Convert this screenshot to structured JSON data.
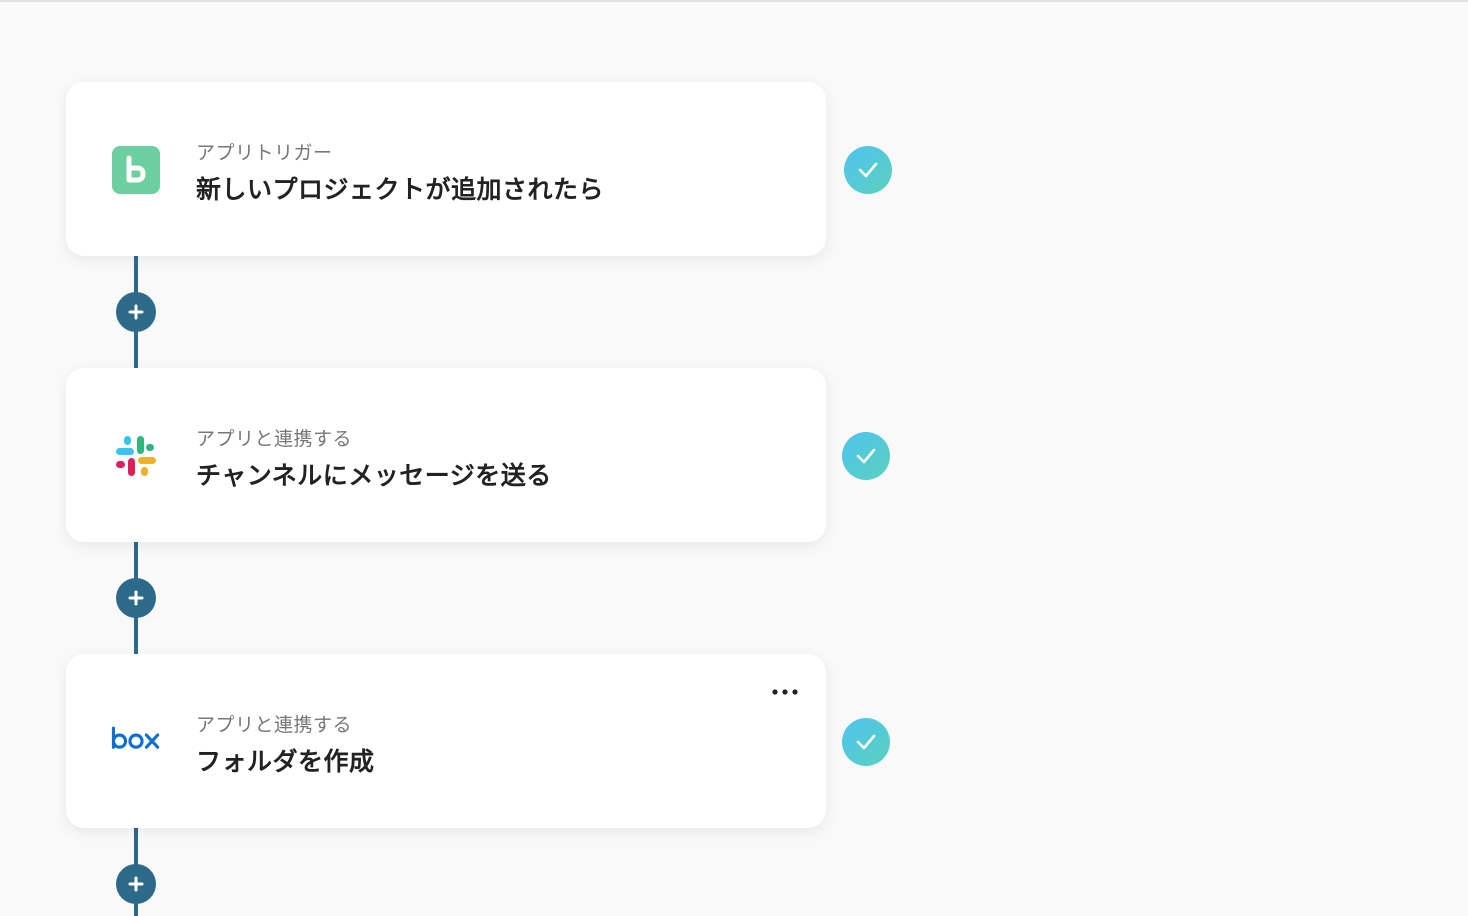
{
  "steps": [
    {
      "subtitle": "アプリトリガー",
      "title": "新しいプロジェクトが追加されたら",
      "app_icon": "backlog-icon",
      "status": "completed"
    },
    {
      "subtitle": "アプリと連携する",
      "title": "チャンネルにメッセージを送る",
      "app_icon": "slack-icon",
      "status": "completed"
    },
    {
      "subtitle": "アプリと連携する",
      "title": "フォルダを作成",
      "app_icon": "box-icon",
      "status": "completed"
    }
  ],
  "colors": {
    "connector": "#2d6a8a",
    "check_gradient_start": "#4fc3f0",
    "check_gradient_end": "#5ad1bd",
    "background": "#f9f9f9"
  },
  "icons": {
    "add": "plus-icon",
    "done": "checkmark-icon",
    "menu": "more-horizontal-icon"
  }
}
